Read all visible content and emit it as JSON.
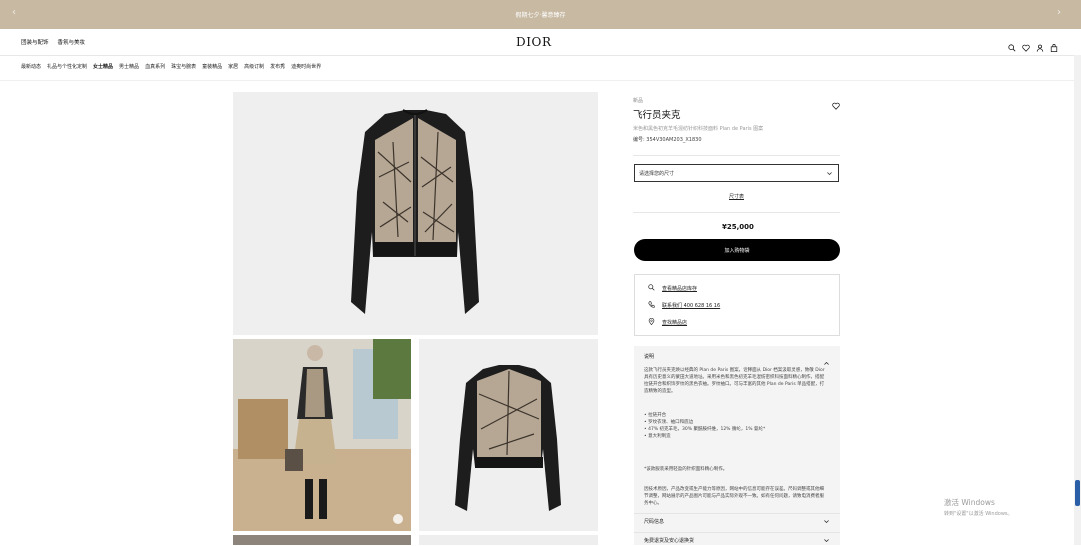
{
  "topbar": {
    "message": "假期七夕·馨意臻存",
    "prev": "‹",
    "next": "›"
  },
  "header": {
    "left_links": [
      "团装与配饰",
      "香氛与美妆"
    ],
    "logo": "DIOR",
    "icons": [
      "search-icon",
      "heart-icon",
      "user-icon",
      "bag-icon"
    ]
  },
  "nav": {
    "items": [
      "最新动态",
      "礼品与个性化定制",
      "女士精品",
      "男士精品",
      "血真系列",
      "珠宝与腕表",
      "童装精品",
      "家居",
      "高级订制",
      "发布秀",
      "迪奥时尚世界"
    ],
    "active_index": 2
  },
  "product": {
    "category": "新品",
    "title": "飞行员夹克",
    "subtitle": "米色和黑色初克羊毛混纺针织科技面料 Plan de Paris 图案",
    "code": "编号: 354V30AM203_X1830",
    "size_placeholder": "请选择您的尺寸",
    "size_guide": "尺寸表",
    "price": "¥25,000",
    "cart_button": "加入购物袋"
  },
  "services": [
    {
      "icon": "search-icon",
      "label": "查看精品店库存"
    },
    {
      "icon": "phone-icon",
      "label": "联系我们 400 628 16 16"
    },
    {
      "icon": "location-pin-icon",
      "label": "查找精品店"
    }
  ],
  "description": {
    "header": "说明",
    "para1": "这款飞行员夹克焕以经典的 Plan de Paris 图案，诠释面从 Dior 档案汲取灵感，致敬 Dior 具有历史意义的蒙田大道地址。采用米色和黑色初克羊毛混纺密织科技面料精心制作，搭配拉链开合和织饰罗纹的黑色衣袖。罗纹袖口。可与丰富的其他 Plan de Paris 单品搭配，打造精致的造型。",
    "bullets": [
      "拉链开合",
      "罗纹衣领、袖口和底边",
      "47% 初克羊毛，30% 聚酰胺纤维，12% 腈纶，1% 氨纶*",
      "意大利制造"
    ],
    "note1": "*该款服装采用轻盈的针织面料精心制作。",
    "note2": "因技术原因，产品改变或生产能力等原因，网站中的信息可能存在误差。尺码调整或其他细节调整，网站展示的产品图片可能与产品实际外观不一致。如有任何问题，请致电消费者服务中心。",
    "acc1": "尺码信息",
    "acc2": "免费退货及安心退换货"
  },
  "watermark": {
    "title": "激活 Windows",
    "subtitle": "转到\"设置\"以激活 Windows。"
  },
  "colors": {
    "topbar": "#c7b9a2",
    "cart": "#000000",
    "scroll_thumb": "#2a5fa8"
  }
}
